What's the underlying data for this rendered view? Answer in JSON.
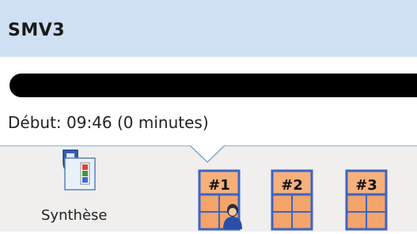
{
  "window": {
    "title": "SMV3"
  },
  "progress": {
    "value": 1.0
  },
  "status": {
    "start_text": "Début: 09:46 (0 minutes)"
  },
  "toolbar": {
    "synthese_label": "Synthèse",
    "pages": [
      "#1",
      "#2",
      "#3"
    ]
  },
  "colors": {
    "titlebar": "#cfe0f2",
    "ribbon_bg": "#f0efee",
    "table_orange": "#f3a46b",
    "table_blue": "#3b63c6"
  }
}
